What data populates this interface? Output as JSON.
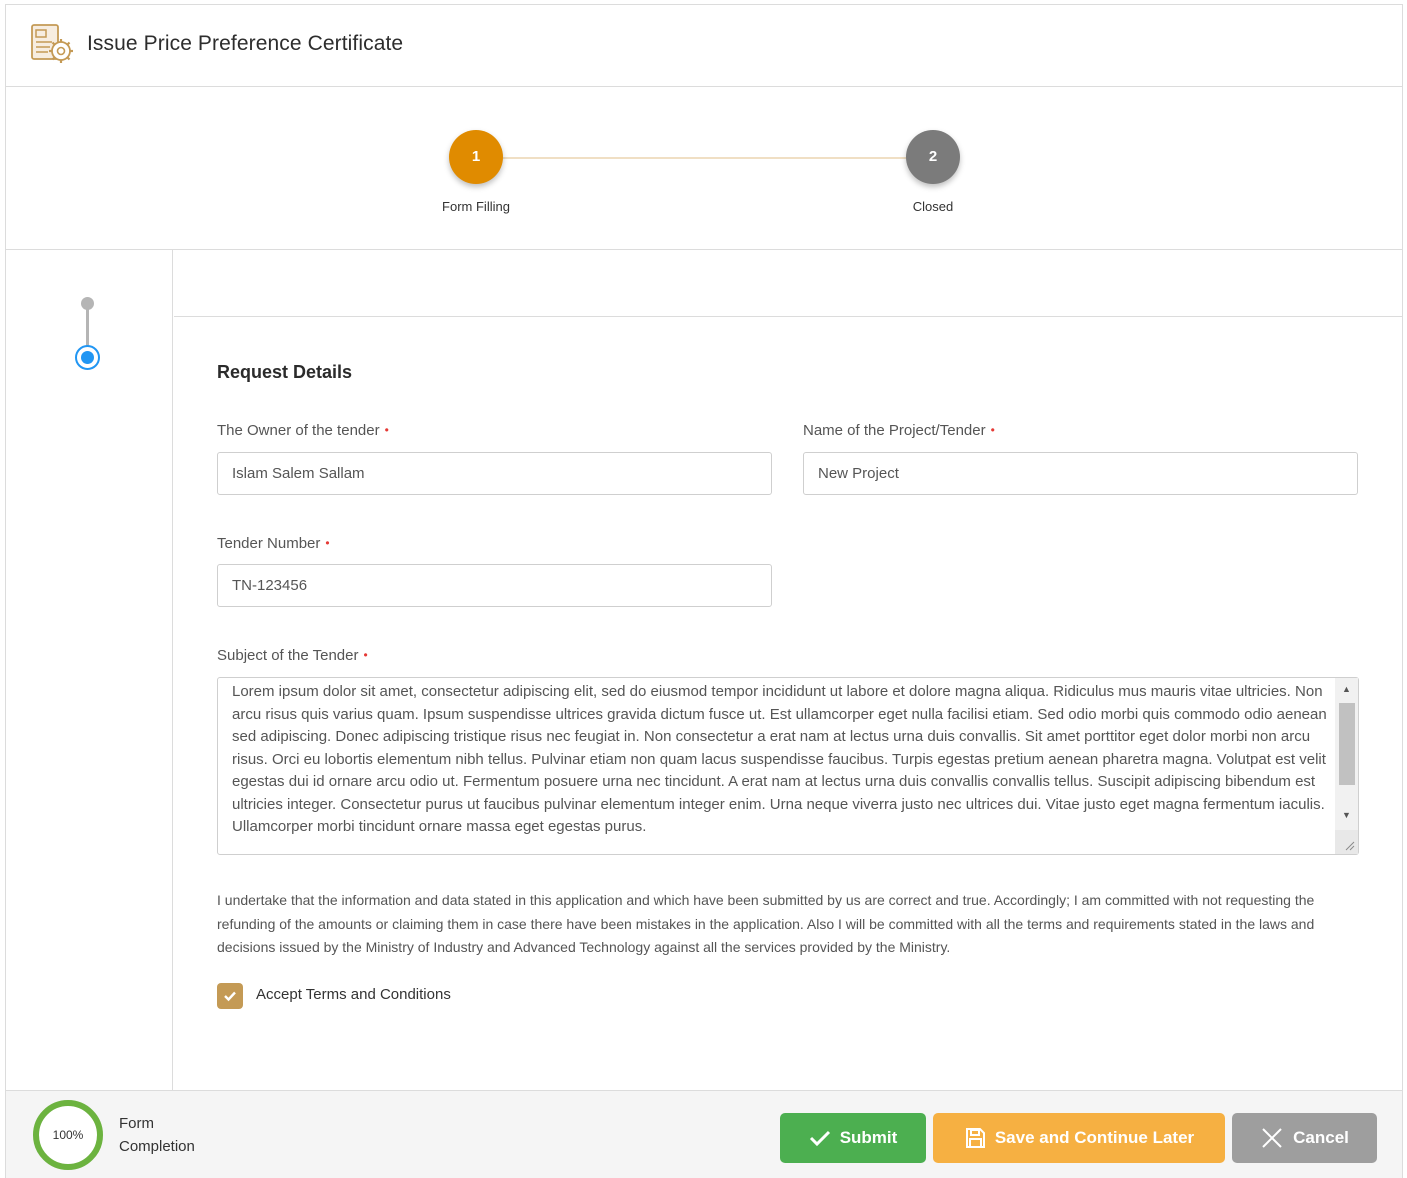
{
  "header": {
    "title": "Issue Price Preference Certificate",
    "icon": "certificate-gear-icon"
  },
  "stepper": {
    "steps": [
      {
        "number": "1",
        "label": "Form Filling",
        "status": "active",
        "color": "#e08b00"
      },
      {
        "number": "2",
        "label": "Closed",
        "status": "pending",
        "color": "#7b7b7b"
      }
    ]
  },
  "form": {
    "section_title": "Request Details",
    "required_mark": "•",
    "owner": {
      "label": "The Owner of the tender",
      "value": "Islam Salem Sallam"
    },
    "project": {
      "label": "Name of the Project/Tender",
      "value": "New Project"
    },
    "tender_number": {
      "label": "Tender Number",
      "value": "TN-123456"
    },
    "subject": {
      "label": "Subject of the Tender",
      "value": "Lorem ipsum dolor sit amet, consectetur adipiscing elit, sed do eiusmod tempor incididunt ut labore et dolore magna aliqua. Ridiculus mus mauris vitae ultricies. Non arcu risus quis varius quam. Ipsum suspendisse ultrices gravida dictum fusce ut. Est ullamcorper eget nulla facilisi etiam. Sed odio morbi quis commodo odio aenean sed adipiscing. Donec adipiscing tristique risus nec feugiat in. Non consectetur a erat nam at lectus urna duis convallis. Sit amet porttitor eget dolor morbi non arcu risus. Orci eu lobortis elementum nibh tellus. Pulvinar etiam non quam lacus suspendisse faucibus. Turpis egestas pretium aenean pharetra magna. Volutpat est velit egestas dui id ornare arcu odio ut. Fermentum posuere urna nec tincidunt. A erat nam at lectus urna duis convallis convallis tellus. Suscipit adipiscing bibendum est ultricies integer. Consectetur purus ut faucibus pulvinar elementum integer enim. Urna neque viverra justo nec ultrices dui. Vitae justo eget magna fermentum iaculis. Ullamcorper morbi tincidunt ornare massa eget egestas purus."
    },
    "declaration": "I undertake that the information and data stated in this application and which have been submitted by us are correct and true. Accordingly; I am committed with not requesting the refunding of the amounts or claiming them in case there have been mistakes in the application. Also I will be committed with all the terms and requirements stated in the laws and decisions issued by the Ministry of Industry and Advanced Technology against all the services provided by the Ministry.",
    "terms": {
      "label": "Accept Terms and Conditions",
      "checked": true
    }
  },
  "footer": {
    "completion": {
      "percent_text": "100%",
      "percent": 100,
      "label_line1": "Form",
      "label_line2": "Completion"
    },
    "buttons": {
      "submit": "Submit",
      "save": "Save and Continue Later",
      "cancel": "Cancel"
    }
  },
  "colors": {
    "accent": "#e08b00",
    "submit": "#4caf50",
    "save": "#f6b042",
    "cancel": "#9e9e9e",
    "checkbox": "#c49a55",
    "active_section": "#2196f3"
  }
}
